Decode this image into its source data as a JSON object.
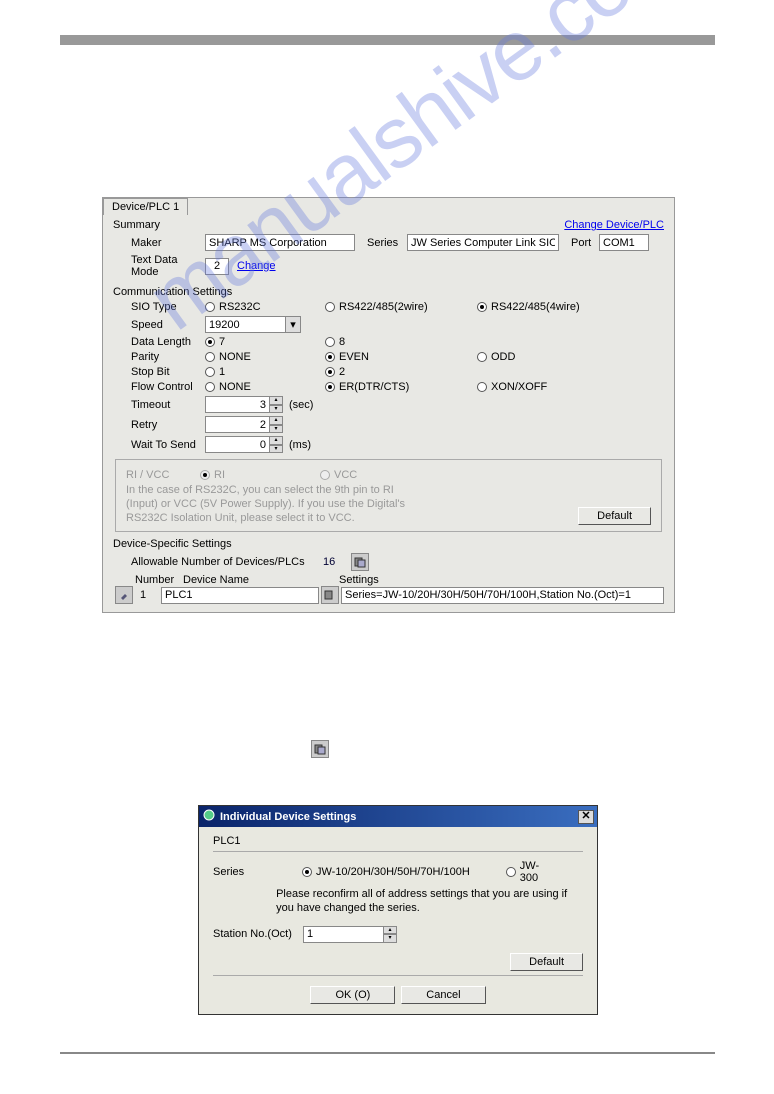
{
  "watermark": "manualshive.com",
  "panel1": {
    "tab": "Device/PLC 1",
    "summary_label": "Summary",
    "change_link": "Change Device/PLC",
    "maker_label": "Maker",
    "maker_value": "SHARP MS Corporation",
    "series_label": "Series",
    "series_value": "JW Series Computer Link SIO",
    "port_label": "Port",
    "port_value": "COM1",
    "tdm_label": "Text Data Mode",
    "tdm_value": "2",
    "tdm_change": "Change",
    "comm_label": "Communication Settings",
    "sio_label": "SIO Type",
    "sio_opts": [
      "RS232C",
      "RS422/485(2wire)",
      "RS422/485(4wire)"
    ],
    "speed_label": "Speed",
    "speed_value": "19200",
    "datalen_label": "Data Length",
    "datalen_opts": [
      "7",
      "8"
    ],
    "parity_label": "Parity",
    "parity_opts": [
      "NONE",
      "EVEN",
      "ODD"
    ],
    "stopbit_label": "Stop Bit",
    "stopbit_opts": [
      "1",
      "2"
    ],
    "flow_label": "Flow Control",
    "flow_opts": [
      "NONE",
      "ER(DTR/CTS)",
      "XON/XOFF"
    ],
    "timeout_label": "Timeout",
    "timeout_value": "3",
    "timeout_unit": "(sec)",
    "retry_label": "Retry",
    "retry_value": "2",
    "wait_label": "Wait To Send",
    "wait_value": "0",
    "wait_unit": "(ms)",
    "rivcc_label": "RI / VCC",
    "rivcc_opts": [
      "RI",
      "VCC"
    ],
    "rivcc_note": "In the case of RS232C, you can select the 9th pin to RI (Input) or VCC (5V Power Supply). If you use the Digital's RS232C Isolation Unit, please select it to VCC.",
    "default_btn": "Default",
    "devspec_label": "Device-Specific Settings",
    "allow_label": "Allowable Number of Devices/PLCs",
    "allow_value": "16",
    "th_number": "Number",
    "th_devname": "Device Name",
    "th_settings": "Settings",
    "row_num": "1",
    "row_name": "PLC1",
    "row_settings": "Series=JW-10/20H/30H/50H/70H/100H,Station No.(Oct)=1"
  },
  "panel2": {
    "title": "Individual Device Settings",
    "name": "PLC1",
    "series_label": "Series",
    "series_opts": [
      "JW-10/20H/30H/50H/70H/100H",
      "JW-300"
    ],
    "series_note": "Please reconfirm all of address settings that you are using if you have changed the series.",
    "station_label": "Station No.(Oct)",
    "station_value": "1",
    "default_btn": "Default",
    "ok_btn": "OK (O)",
    "cancel_btn": "Cancel"
  }
}
